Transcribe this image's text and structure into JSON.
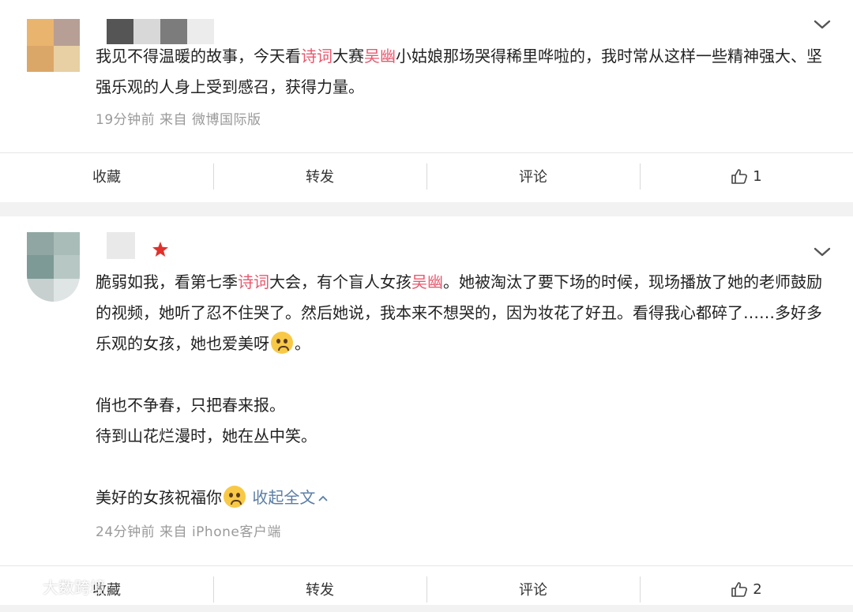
{
  "posts": [
    {
      "text_parts": [
        "我见不得温暖的故事，今天看",
        "诗词",
        "大赛",
        "吴幽",
        "小姑娘那场哭得稀里哗啦的，我时常从这样一些精神强大、坚强乐观的人身上受到感召，获得力量。"
      ],
      "meta": "19分钟前  来自 微博国际版",
      "actions": {
        "collect": "收藏",
        "repost": "转发",
        "comment": "评论",
        "like_count": "1"
      }
    },
    {
      "p1_parts": [
        "脆弱如我，看第七季",
        "诗词",
        "大会，有个盲人女孩",
        "吴幽",
        "。她被淘汰了要下场的时候，现场播放了她的老师鼓励的视频，她听了忍不住哭了。然后她说，我本来不想哭的，因为妆花了好丑。看得我心都碎了……多好多乐观的女孩，她也爱美呀",
        "。"
      ],
      "poem_line1": "俏也不争春，只把春来报。",
      "poem_line2": "待到山花烂漫时，她在丛中笑。",
      "closing": "美好的女孩祝福你",
      "expand_label": "收起全文",
      "meta": "24分钟前  来自 iPhone客户端",
      "actions": {
        "collect": "收藏",
        "repost": "转发",
        "comment": "评论",
        "like_count": "2"
      }
    }
  ],
  "watermark": "大数跨境",
  "colors": {
    "keyword": "#e8586e",
    "link": "#5b7ea6",
    "meta": "#9a9a9a",
    "verified_star": "#e0312b"
  },
  "icons": [
    "chevron-down-icon",
    "thumbs-up-icon",
    "pleading-face-emoji",
    "verified-star-icon"
  ]
}
